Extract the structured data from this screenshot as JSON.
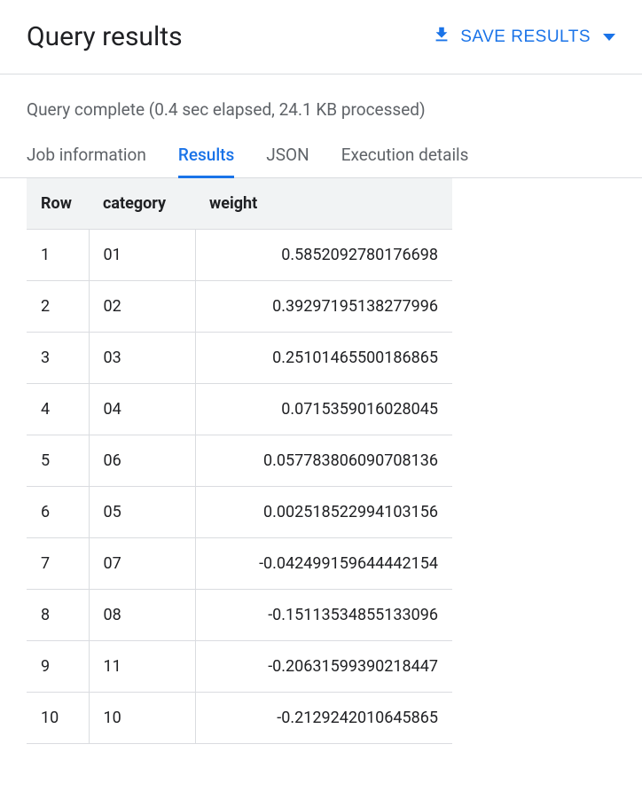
{
  "header": {
    "title": "Query results",
    "save_label": "SAVE RESULTS"
  },
  "status": "Query complete (0.4 sec elapsed, 24.1 KB processed)",
  "tabs": [
    {
      "label": "Job information"
    },
    {
      "label": "Results"
    },
    {
      "label": "JSON"
    },
    {
      "label": "Execution details"
    }
  ],
  "table": {
    "columns": [
      "Row",
      "category",
      "weight"
    ],
    "rows": [
      {
        "row": "1",
        "category": "01",
        "weight": "0.5852092780176698"
      },
      {
        "row": "2",
        "category": "02",
        "weight": "0.39297195138277996"
      },
      {
        "row": "3",
        "category": "03",
        "weight": "0.25101465500186865"
      },
      {
        "row": "4",
        "category": "04",
        "weight": "0.0715359016028045"
      },
      {
        "row": "5",
        "category": "06",
        "weight": "0.057783806090708136"
      },
      {
        "row": "6",
        "category": "05",
        "weight": "0.002518522994103156"
      },
      {
        "row": "7",
        "category": "07",
        "weight": "-0.042499159644442154"
      },
      {
        "row": "8",
        "category": "08",
        "weight": "-0.15113534855133096"
      },
      {
        "row": "9",
        "category": "11",
        "weight": "-0.20631599390218447"
      },
      {
        "row": "10",
        "category": "10",
        "weight": "-0.2129242010645865"
      }
    ]
  }
}
